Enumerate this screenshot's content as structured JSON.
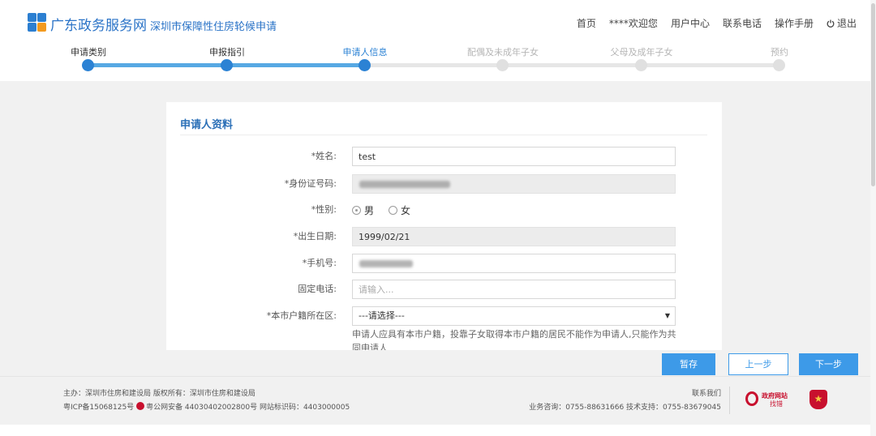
{
  "header": {
    "brand": "广东政务服务网",
    "subtitle": "深圳市保障性住房轮候申请",
    "nav": {
      "home": "首页",
      "welcome": "****欢迎您",
      "user_center": "用户中心",
      "contact": "联系电话",
      "manual": "操作手册",
      "logout": "退出"
    }
  },
  "steps": [
    {
      "label": "申请类别",
      "state": "done"
    },
    {
      "label": "申报指引",
      "state": "done"
    },
    {
      "label": "申请人信息",
      "state": "current"
    },
    {
      "label": "配偶及未成年子女",
      "state": "todo"
    },
    {
      "label": "父母及成年子女",
      "state": "todo"
    },
    {
      "label": "预约",
      "state": "todo"
    }
  ],
  "form": {
    "title": "申请人资料",
    "name_label": "*姓名:",
    "name_value": "test",
    "id_label": "*身份证号码:",
    "gender_label": "*性别:",
    "gender_options": [
      "男",
      "女"
    ],
    "gender_selected": "男",
    "birth_label": "*出生日期:",
    "birth_value": "1999/02/21",
    "mobile_label": "*手机号:",
    "phone_label": "固定电话:",
    "phone_placeholder": "请输入...",
    "district_label": "*本市户籍所在区:",
    "district_value": "---请选择---",
    "hint": "申请人应具有本市户籍，投靠子女取得本市户籍的居民不能作为申请人,只能作为共同申请人"
  },
  "buttons": {
    "save": "暂存",
    "prev": "上一步",
    "next": "下一步"
  },
  "footer": {
    "line1": "主办：深圳市住房和建设局 版权所有：深圳市住房和建设局",
    "icp": "粤ICP备15068125号",
    "police": "粤公网安备 44030402002800号 网站标识码：4403000005",
    "contact_us": "联系我们",
    "support": "业务咨询：0755-88631666 技术支持：0755-83679045",
    "gov_badge_top": "政府网站",
    "gov_badge_bottom": "找错"
  },
  "colors": {
    "primary": "#3d9ae8",
    "brand": "#2a73c7",
    "step_done": "#2b82d4"
  }
}
